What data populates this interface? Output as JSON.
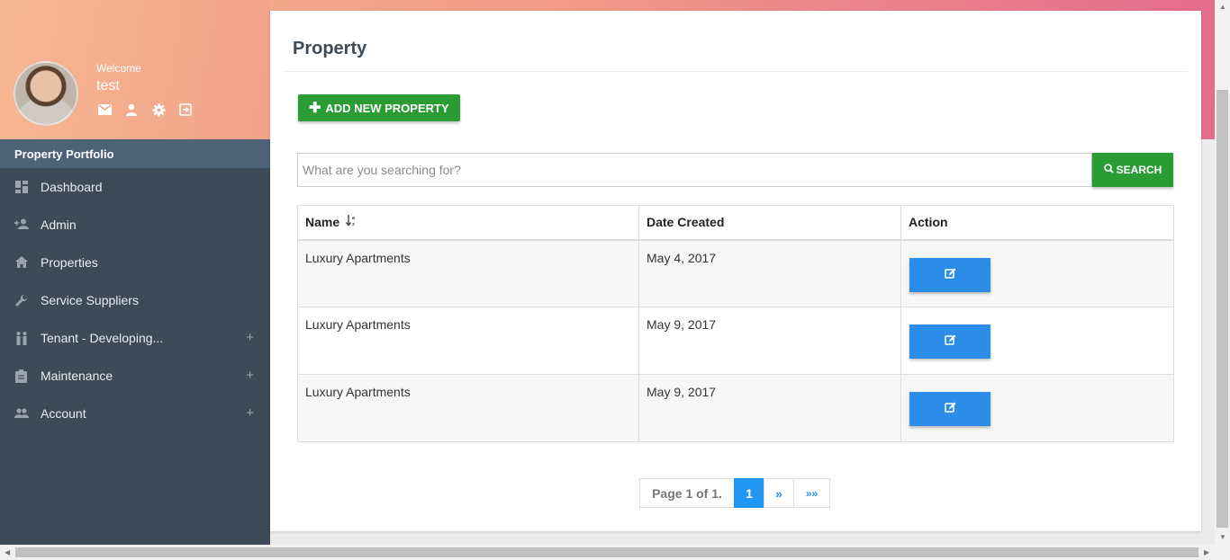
{
  "profile": {
    "welcome": "Welcome",
    "username": "test",
    "icons": [
      "mail-icon",
      "user-icon",
      "settings-icon",
      "logout-icon"
    ]
  },
  "sidebar": {
    "section_title": "Property Portfolio",
    "items": [
      {
        "label": "Dashboard",
        "icon": "dashboard-icon",
        "expandable": false
      },
      {
        "label": "Admin",
        "icon": "add-person-icon",
        "expandable": false
      },
      {
        "label": "Properties",
        "icon": "home-icon",
        "expandable": false
      },
      {
        "label": "Service Suppliers",
        "icon": "wrench-icon",
        "expandable": false
      },
      {
        "label": "Tenant - Developing...",
        "icon": "people-icon",
        "expandable": true
      },
      {
        "label": "Maintenance",
        "icon": "clipboard-icon",
        "expandable": true
      },
      {
        "label": "Account",
        "icon": "group-icon",
        "expandable": true
      }
    ],
    "expand_symbol": "+"
  },
  "main": {
    "title": "Property",
    "add_button_label": "ADD NEW PROPERTY",
    "search_placeholder": "What are you searching for?",
    "search_button_label": "SEARCH",
    "table": {
      "headers": [
        "Name",
        "Date Created",
        "Action"
      ],
      "rows": [
        {
          "name": "Luxury Apartments",
          "date": "May 4, 2017"
        },
        {
          "name": "Luxury Apartments",
          "date": "May 9, 2017"
        },
        {
          "name": "Luxury Apartments",
          "date": "May 9, 2017"
        }
      ]
    },
    "pagination": {
      "info": "Page 1 of 1.",
      "current": "1",
      "next": "»",
      "last": "»»"
    }
  },
  "colors": {
    "accent_green": "#2a9c34",
    "accent_blue": "#2b8de8",
    "sidebar_bg": "#3d4b59"
  }
}
